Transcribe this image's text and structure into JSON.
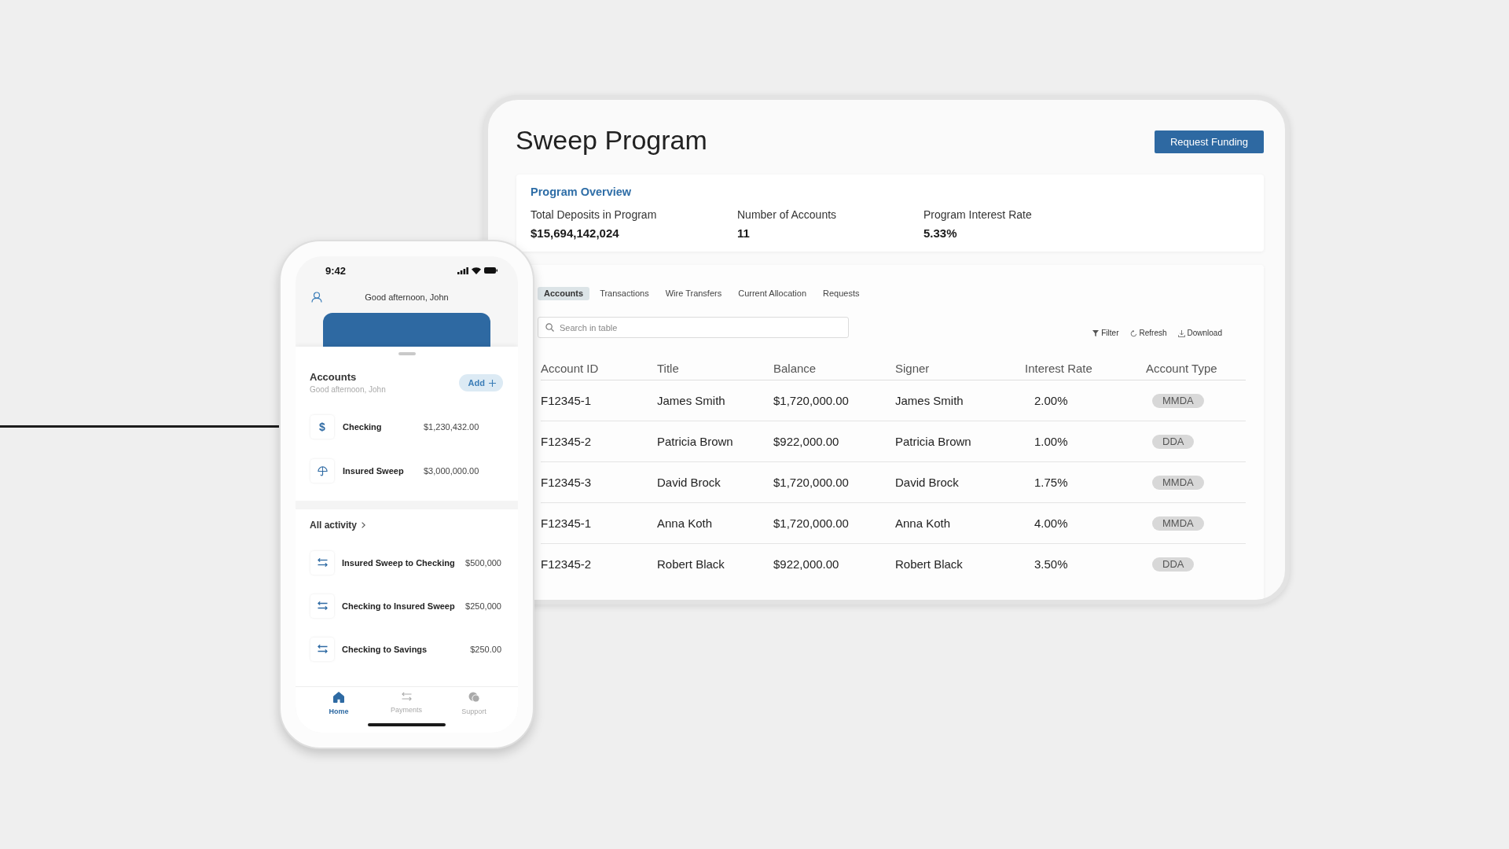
{
  "tablet": {
    "title": "Sweep Program",
    "request_button": "Request Funding",
    "overview": {
      "heading": "Program Overview",
      "stats": [
        {
          "label": "Total Deposits in Program",
          "value": "$15,694,142,024"
        },
        {
          "label": "Number of Accounts",
          "value": "11"
        },
        {
          "label": "Program Interest Rate",
          "value": "5.33%"
        }
      ]
    },
    "tabs": [
      {
        "label": "Accounts",
        "selected": true
      },
      {
        "label": "Transactions",
        "selected": false
      },
      {
        "label": "Wire Transfers",
        "selected": false
      },
      {
        "label": "Current Allocation",
        "selected": false
      },
      {
        "label": "Requests",
        "selected": false
      }
    ],
    "search": {
      "placeholder": "Search in table"
    },
    "actions": [
      {
        "kind": "filter",
        "label": "Filter"
      },
      {
        "kind": "refresh",
        "label": "Refresh"
      },
      {
        "kind": "download",
        "label": "Download"
      }
    ],
    "table": {
      "columns": [
        "Account ID",
        "Title",
        "Balance",
        "Signer",
        "Interest Rate",
        "Account Type"
      ],
      "rows": [
        [
          "F12345-1",
          "James Smith",
          "$1,720,000.00",
          "James Smith",
          "2.00%",
          "MMDA"
        ],
        [
          "F12345-2",
          "Patricia Brown",
          "$922,000.00",
          "Patricia Brown",
          "1.00%",
          "DDA"
        ],
        [
          "F12345-3",
          "David Brock",
          "$1,720,000.00",
          "David Brock",
          "1.75%",
          "MMDA"
        ],
        [
          "F12345-1",
          "Anna Koth",
          "$1,720,000.00",
          "Anna Koth",
          "4.00%",
          "MMDA"
        ],
        [
          "F12345-2",
          "Robert Black",
          "$922,000.00",
          "Robert Black",
          "3.50%",
          "DDA"
        ]
      ]
    }
  },
  "phone": {
    "status_bar": {
      "time": "9:42"
    },
    "greeting": "Good afternoon, John",
    "accounts": {
      "heading": "Accounts",
      "subtitle": "Good afternoon, John",
      "add_button": "Add",
      "items": [
        {
          "kind": "glyph",
          "glyph": "$",
          "name": "Checking",
          "amount": "$1,230,432.00"
        },
        {
          "kind": "umbrella",
          "name": "Insured Sweep",
          "amount": "$3,000,000.00"
        }
      ]
    },
    "activity": {
      "heading": "All activity",
      "items": [
        {
          "name": "Insured Sweep to Checking",
          "amount": "$500,000"
        },
        {
          "name": "Checking to Insured Sweep",
          "amount": "$250,000"
        },
        {
          "name": "Checking to Savings",
          "amount": "$250.00"
        }
      ]
    },
    "nav": [
      {
        "kind": "home",
        "label": "Home",
        "selected": true
      },
      {
        "kind": "transfer",
        "label": "Payments",
        "selected": false
      },
      {
        "kind": "chat",
        "label": "Support",
        "selected": false
      }
    ]
  }
}
